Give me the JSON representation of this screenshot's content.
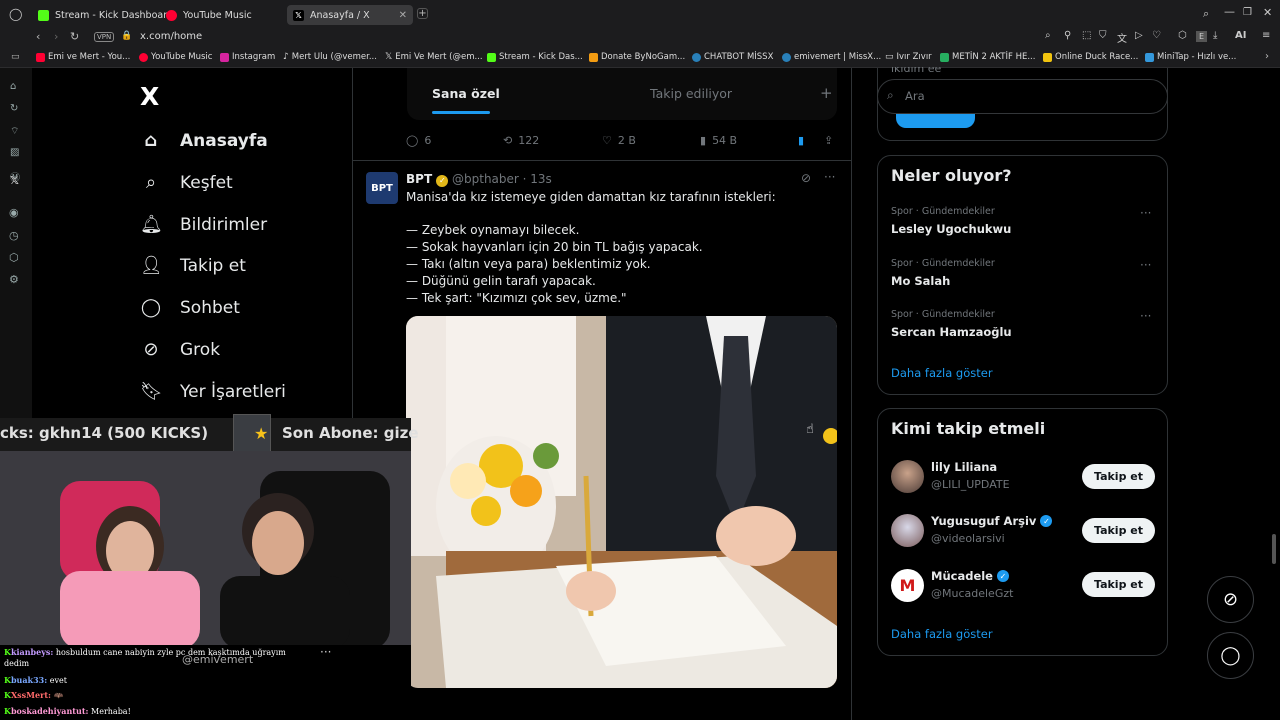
{
  "browser": {
    "tabs": [
      {
        "label": "Stream - Kick Dashboard",
        "icon": "kick-icon"
      },
      {
        "label": "YouTube Music",
        "icon": "youtube-music-icon"
      },
      {
        "label": "Anasayfa / X",
        "icon": "x-icon",
        "active": true
      }
    ],
    "vpn_label": "VPN",
    "url": "x.com/home",
    "ai_label": "AI",
    "bookmarks": [
      "Emi ve Mert - You...",
      "YouTube Music",
      "Instagram",
      "Mert Ulu (@vemer...",
      "Emi Ve Mert (@em...",
      "Stream - Kick Das...",
      "Donate ByNoGam...",
      "CHATBOT MİSSX",
      "emivemert | MissX...",
      "Ivır Zıvır",
      "METİN 2 AKTİF HE...",
      "Online Duck Race...",
      "MiniTap - Hızlı ve..."
    ]
  },
  "left_nav": {
    "logo": "X",
    "items": [
      {
        "label": "Anasayfa",
        "icon": "home-icon"
      },
      {
        "label": "Keşfet",
        "icon": "search-icon"
      },
      {
        "label": "Bildirimler",
        "icon": "bell-icon"
      },
      {
        "label": "Takip et",
        "icon": "add-person-icon"
      },
      {
        "label": "Sohbet",
        "icon": "chat-bubble-icon"
      },
      {
        "label": "Grok",
        "icon": "grok-icon"
      },
      {
        "label": "Yer İşaretleri",
        "icon": "bookmark-icon"
      }
    ]
  },
  "feed": {
    "tabs": [
      "Sana özel",
      "Takip ediliyor"
    ],
    "prev_post_actions": {
      "replies": "6",
      "reposts": "122",
      "likes": "2 B",
      "views": "54 B"
    },
    "post": {
      "avatar_text": "BPT",
      "author": "BPT",
      "handle": "@bpthaber · 13s",
      "lines": [
        "Manisa'da kız istemeye giden damattan kız tarafının istekleri:",
        "— Zeybek oynamayı bilecek.",
        "— Sokak hayvanları için 20 bin TL bağış yapacak.",
        "— Takı (altın veya para) beklentimiz yok.",
        "— Düğünü gelin tarafı yapacak.",
        "— Tek şart: \"Kızımızı çok sev, üzme.\""
      ]
    }
  },
  "right": {
    "search_placeholder": "Ara",
    "top_label": "ıkldım ee",
    "trends_title": "Neler oluyor?",
    "trends": [
      {
        "meta": "Spor · Gündemdekiler",
        "name": "Lesley Ugochukwu"
      },
      {
        "meta": "Spor · Gündemdekiler",
        "name": "Mo Salah"
      },
      {
        "meta": "Spor · Gündemdekiler",
        "name": "Sercan Hamzaoğlu"
      }
    ],
    "trends_more": "Daha fazla göster",
    "who_title": "Kimi takip etmeli",
    "who": [
      {
        "name": "lily Liliana",
        "handle": "@LILI_UPDATE",
        "verified": false,
        "button": "Takip et"
      },
      {
        "name": "Yugusuguf Arşiv",
        "handle": "@videolarsivi",
        "verified": true,
        "button": "Takip et"
      },
      {
        "name": "Mücadele",
        "handle": "@MucadeleGzt",
        "verified": true,
        "button": "Takip et"
      }
    ],
    "who_more": "Daha fazla göster"
  },
  "stream_overlay": {
    "ticker_left": "cks: gkhn14  (500 KICKS)",
    "ticker_right": "Son Abone: gize",
    "cam_handle": "@emivemert",
    "chat": [
      {
        "user": "kianbeys:",
        "msg": "hosbuldum cane nabiyin zyle pc dem kaşktımda uğrayım"
      },
      {
        "user": "",
        "msg": "dedim"
      },
      {
        "user": "buak33:",
        "msg": "evet"
      },
      {
        "user": "XssMert:",
        "msg": "🦇"
      },
      {
        "user": "boskadehiyantut:",
        "msg": "Merhaba!"
      }
    ]
  },
  "colors": {
    "accent": "#1d9bf0",
    "kick_green": "#53fc18",
    "background": "#000000"
  }
}
